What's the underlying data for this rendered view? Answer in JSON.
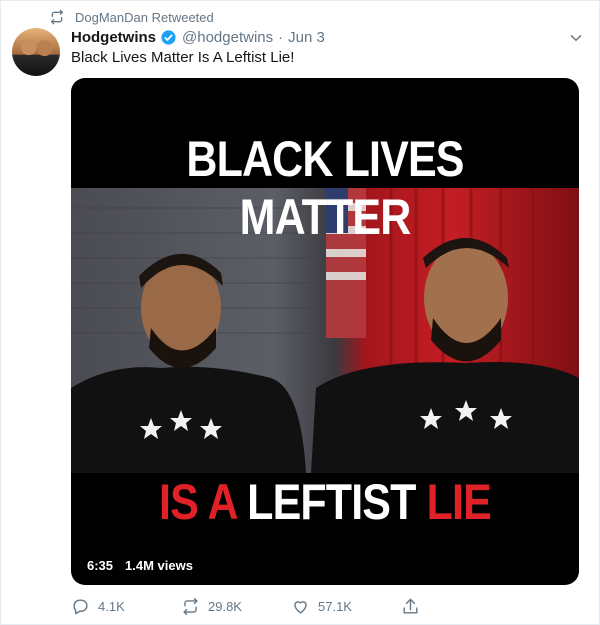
{
  "retweet": {
    "icon": "retweet-icon",
    "label": "DogManDan Retweeted"
  },
  "author": {
    "name": "Hodgetwins",
    "handle": "@hodgetwins",
    "separator": "·",
    "date": "Jun 3",
    "verified_color": "#1da1f2"
  },
  "tweet": {
    "text": "Black Lives Matter Is A Leftist Lie!"
  },
  "media": {
    "caption_top": "BLACK LIVES MATTER",
    "caption_bottom_1": "IS A",
    "caption_bottom_2": "LEFTIST",
    "caption_bottom_3": "LIE",
    "duration": "6:35",
    "views": "1.4M views"
  },
  "actions": {
    "reply": {
      "icon": "reply-icon",
      "count": "4.1K"
    },
    "retweet": {
      "icon": "retweet-icon",
      "count": "29.8K"
    },
    "like": {
      "icon": "heart-icon",
      "count": "57.1K"
    },
    "share": {
      "icon": "share-icon"
    }
  },
  "colors": {
    "accent": "#1da1f2",
    "muted": "#657786",
    "caption_red": "#e02128"
  }
}
